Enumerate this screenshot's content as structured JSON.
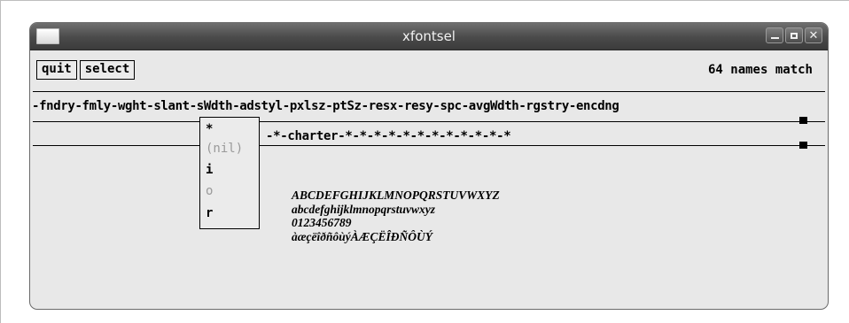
{
  "window": {
    "title": "xfontsel"
  },
  "toolbar": {
    "quit_label": "quit",
    "select_label": "select",
    "match_count": "64 names match"
  },
  "pattern": {
    "fields_line": "-fndry-fmly-wght-slant-sWdth-adstyl-pxlsz-ptSz-resx-resy-spc-avgWdth-rgstry-encdng",
    "current_font": "-*-charter-*-*-*-*-*-*-*-*-*-*-*-*"
  },
  "slant_menu": {
    "items": [
      "*",
      "(nil)",
      "i",
      "o",
      "r"
    ]
  },
  "sample_text": {
    "line1": "ABCDEFGHIJKLMNOPQRSTUVWXYZ",
    "line2": "abcdefghijklmnopqrstuvwxyz",
    "line3": "0123456789",
    "line4": "àæçëîðñôùýÀÆÇËÎÐÑÔÙÝ"
  },
  "icons": {
    "app_menu": "window-menu-icon",
    "minimize": "minimize-icon",
    "maximize": "maximize-icon",
    "close": "close-icon"
  }
}
